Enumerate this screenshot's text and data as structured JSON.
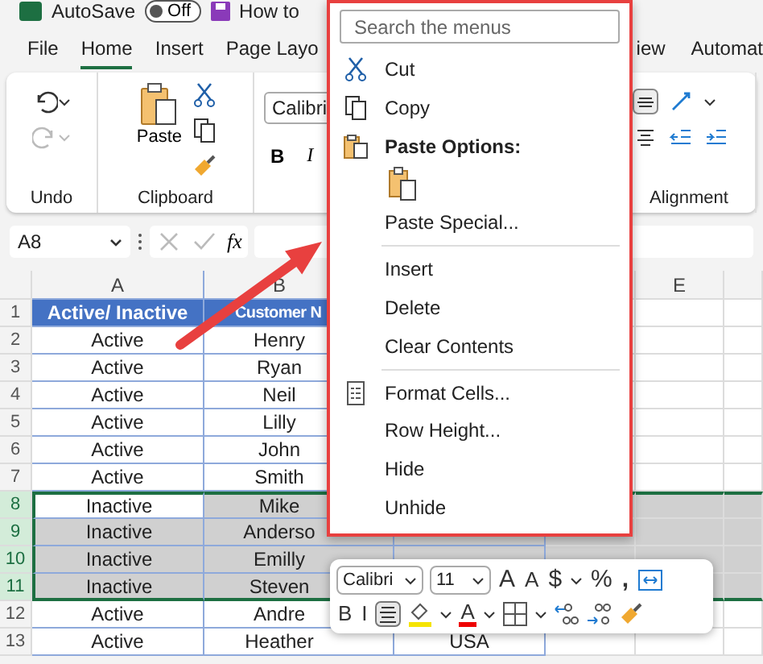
{
  "title_bar": {
    "autosave": "AutoSave",
    "toggle": {
      "label": "Off",
      "on": false
    },
    "doc_title": "How to"
  },
  "ribbon_tabs": [
    {
      "label": "File",
      "selected": false
    },
    {
      "label": "Home",
      "selected": true
    },
    {
      "label": "Insert",
      "selected": false
    },
    {
      "label": "Page Layo",
      "selected": false
    },
    {
      "label": "iew",
      "selected": false
    },
    {
      "label": "Automat",
      "selected": false
    }
  ],
  "ribbon": {
    "undo_label": "Undo",
    "paste_label": "Paste",
    "clipboard_label": "Clipboard",
    "font_name": "Calibri",
    "bold": "B",
    "italic": "I",
    "alignment_label": "Alignment"
  },
  "formula_bar": {
    "name_box": "A8",
    "fx": "fx"
  },
  "column_headers": {
    "a": "A",
    "b": "B",
    "e": "E"
  },
  "rows": [
    {
      "num": "1",
      "kind": "header",
      "a": "Active/ Inactive",
      "b": "Customer N",
      "selected": false,
      "active": false
    },
    {
      "num": "2",
      "kind": "data",
      "a": "Active",
      "b": "Henry",
      "selected": false,
      "active": false
    },
    {
      "num": "3",
      "kind": "data",
      "a": "Active",
      "b": "Ryan",
      "selected": false,
      "active": false
    },
    {
      "num": "4",
      "kind": "data",
      "a": "Active",
      "b": "Neil",
      "selected": false,
      "active": false
    },
    {
      "num": "5",
      "kind": "data",
      "a": "Active",
      "b": "Lilly",
      "selected": false,
      "active": false
    },
    {
      "num": "6",
      "kind": "data",
      "a": "Active",
      "b": "John",
      "selected": false,
      "active": false
    },
    {
      "num": "7",
      "kind": "data",
      "a": "Active",
      "b": "Smith",
      "selected": false,
      "active": false
    },
    {
      "num": "8",
      "kind": "data",
      "a": "Inactive",
      "b": "Mike",
      "selected": true,
      "active": true
    },
    {
      "num": "9",
      "kind": "data",
      "a": "Inactive",
      "b": "Anderso",
      "selected": true,
      "active": false
    },
    {
      "num": "10",
      "kind": "data",
      "a": "Inactive",
      "b": "Emilly",
      "selected": true,
      "active": false
    },
    {
      "num": "11",
      "kind": "data",
      "a": "Inactive",
      "b": "Steven",
      "selected": true,
      "active": false
    },
    {
      "num": "12",
      "kind": "data",
      "a": "Active",
      "b": "Andre",
      "selected": false,
      "active": false
    },
    {
      "num": "13",
      "kind": "data",
      "a": "Active",
      "b": "Heather",
      "c": "USA",
      "selected": false,
      "active": false
    }
  ],
  "context_menu": [
    {
      "kind": "search",
      "placeholder": "Search the menus"
    },
    {
      "kind": "cut",
      "label": "Cut"
    },
    {
      "kind": "copy",
      "label": "Copy"
    },
    {
      "kind": "paste-heading",
      "label": "Paste Options:"
    },
    {
      "kind": "paste-option"
    },
    {
      "kind": "command",
      "label": "Paste Special..."
    },
    {
      "kind": "command",
      "label": "Insert",
      "divider_before": true
    },
    {
      "kind": "command",
      "label": "Delete"
    },
    {
      "kind": "command",
      "label": "Clear Contents"
    },
    {
      "kind": "format",
      "label": "Format Cells...",
      "divider_before": true
    },
    {
      "kind": "command",
      "label": "Row Height..."
    },
    {
      "kind": "command",
      "label": "Hide"
    },
    {
      "kind": "command",
      "label": "Unhide"
    }
  ],
  "mini_toolbar": {
    "font": "Calibri",
    "size": "11",
    "grow": "A",
    "shrink": "A",
    "dollar": "$",
    "percent": "%",
    "comma": ",",
    "bold": "B",
    "italic": "I",
    "center_selected": true,
    "font_color_letter": "A"
  }
}
